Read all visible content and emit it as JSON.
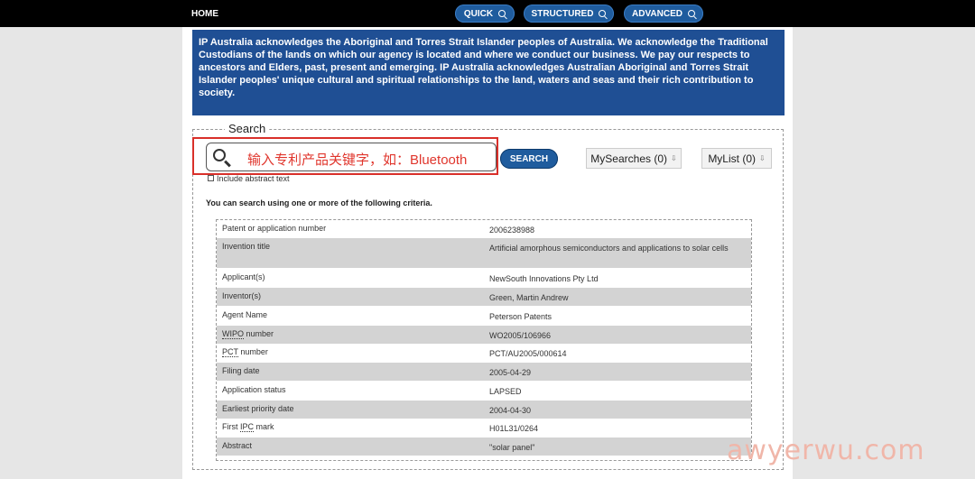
{
  "topnav": {
    "home": "HOME",
    "quick": "QUICK",
    "structured": "STRUCTURED",
    "advanced": "ADVANCED"
  },
  "acknowledgement": "IP Australia acknowledges the Aboriginal and Torres Strait Islander peoples of Australia. We acknowledge the Traditional Custodians of the lands on which our agency is located and where we conduct our business. We pay our respects to ancestors and Elders, past, present and emerging. IP Australia acknowledges Australian Aboriginal and Torres Strait Islander peoples' unique cultural and spiritual relationships to the land, waters and seas and their rich contribution to society.",
  "search": {
    "legend": "Search",
    "placeholder": "输入专利产品关键字，如：Bluetooth",
    "button": "SEARCH",
    "my_searches": "MySearches (0)",
    "my_list": "MyList (0)",
    "include_abstract": "Include abstract text",
    "criteria_text": "You can search using one or more of the following criteria."
  },
  "criteria": [
    {
      "label": "Patent or application number",
      "value": "2006238988"
    },
    {
      "label": "Invention title",
      "value": "Artificial amorphous semiconductors and applications to solar cells"
    },
    {
      "label": "Applicant(s)",
      "value": "NewSouth Innovations Pty Ltd"
    },
    {
      "label": "Inventor(s)",
      "value": "Green, Martin Andrew"
    },
    {
      "label": "Agent Name",
      "value": "Peterson Patents"
    },
    {
      "label_abbr": "WIPO",
      "label_rest": " number",
      "value": "WO2005/106966"
    },
    {
      "label_abbr": "PCT",
      "label_rest": " number",
      "value": "PCT/AU2005/000614"
    },
    {
      "label": "Filing date",
      "value": "2005-04-29"
    },
    {
      "label": "Application status",
      "value": "LAPSED"
    },
    {
      "label": "Earliest priority date",
      "value": "2004-04-30"
    },
    {
      "label_pre": "First ",
      "label_abbr": "IPC",
      "label_rest": " mark",
      "value": "H01L31/0264"
    },
    {
      "label": "Abstract",
      "value": "\"solar panel\""
    }
  ],
  "watermark": "awyerwu.com",
  "colors": {
    "nav_button": "#1f5c9e",
    "banner": "#1f4f94",
    "highlight_box": "#d9302a",
    "row_grey": "#d3d3d3"
  }
}
